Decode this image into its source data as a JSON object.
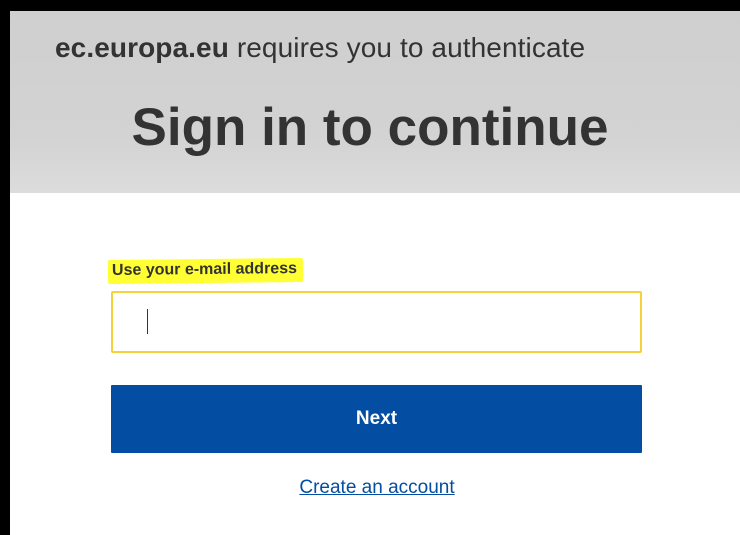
{
  "header": {
    "domain": "ec.europa.eu",
    "auth_message": " requires you to authenticate",
    "title": "Sign in to continue"
  },
  "form": {
    "email_label": "Use your e-mail address",
    "email_value": "",
    "email_placeholder": "",
    "next_label": "Next",
    "create_account_label": "Create an account"
  },
  "colors": {
    "header_bg": "#d3d3d3",
    "highlight": "#ffff33",
    "input_border": "#f5d23a",
    "primary_button": "#034ea2",
    "link": "#034ea2",
    "text": "#333333"
  }
}
